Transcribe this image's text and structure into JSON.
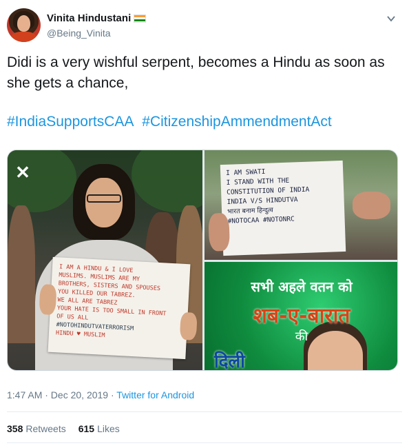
{
  "user": {
    "display_name": "Vinita Hindustani",
    "handle": "@Being_Vinita",
    "flag_icon": "india-flag-icon"
  },
  "tweet": {
    "text": "Didi is a very wishful serpent, becomes a Hindu as soon as she gets a chance,",
    "hashtags": [
      "#IndiaSupportsCAA",
      "#CitizenshipAmmendmentAct"
    ]
  },
  "media": {
    "left_poster": {
      "lines": [
        "I am a Hindu & I love",
        "Muslims. Muslims are my",
        "brothers, sisters and spouses",
        "You killed our Tabrez.",
        "We all are Tabrez",
        "Your hate is too small in front",
        "of us all",
        "#NoToHindutvaTerrorism",
        "Hindu ♥ Muslim"
      ]
    },
    "right_top_placard": {
      "lines": [
        "I am Swati",
        "I stand with the",
        "Constitution of India",
        "India v/s Hindutva",
        "भारत बनाम हिन्दुत्व",
        "#NoToCAA #NoToNRC"
      ]
    },
    "right_bottom_card": {
      "line1": "सभी अहले वतन को",
      "line2": "शब-ए-बारात",
      "line3": "की",
      "line4": "दिली"
    }
  },
  "meta": {
    "time": "1:47 AM · Dec 20, 2019",
    "separator": " · ",
    "source": "Twitter for Android"
  },
  "stats": {
    "retweets_count": "358",
    "retweets_label": "Retweets",
    "likes_count": "615",
    "likes_label": "Likes"
  },
  "colors": {
    "link": "#1b95e0",
    "secondary_text": "#657786",
    "primary_text": "#14171a"
  }
}
